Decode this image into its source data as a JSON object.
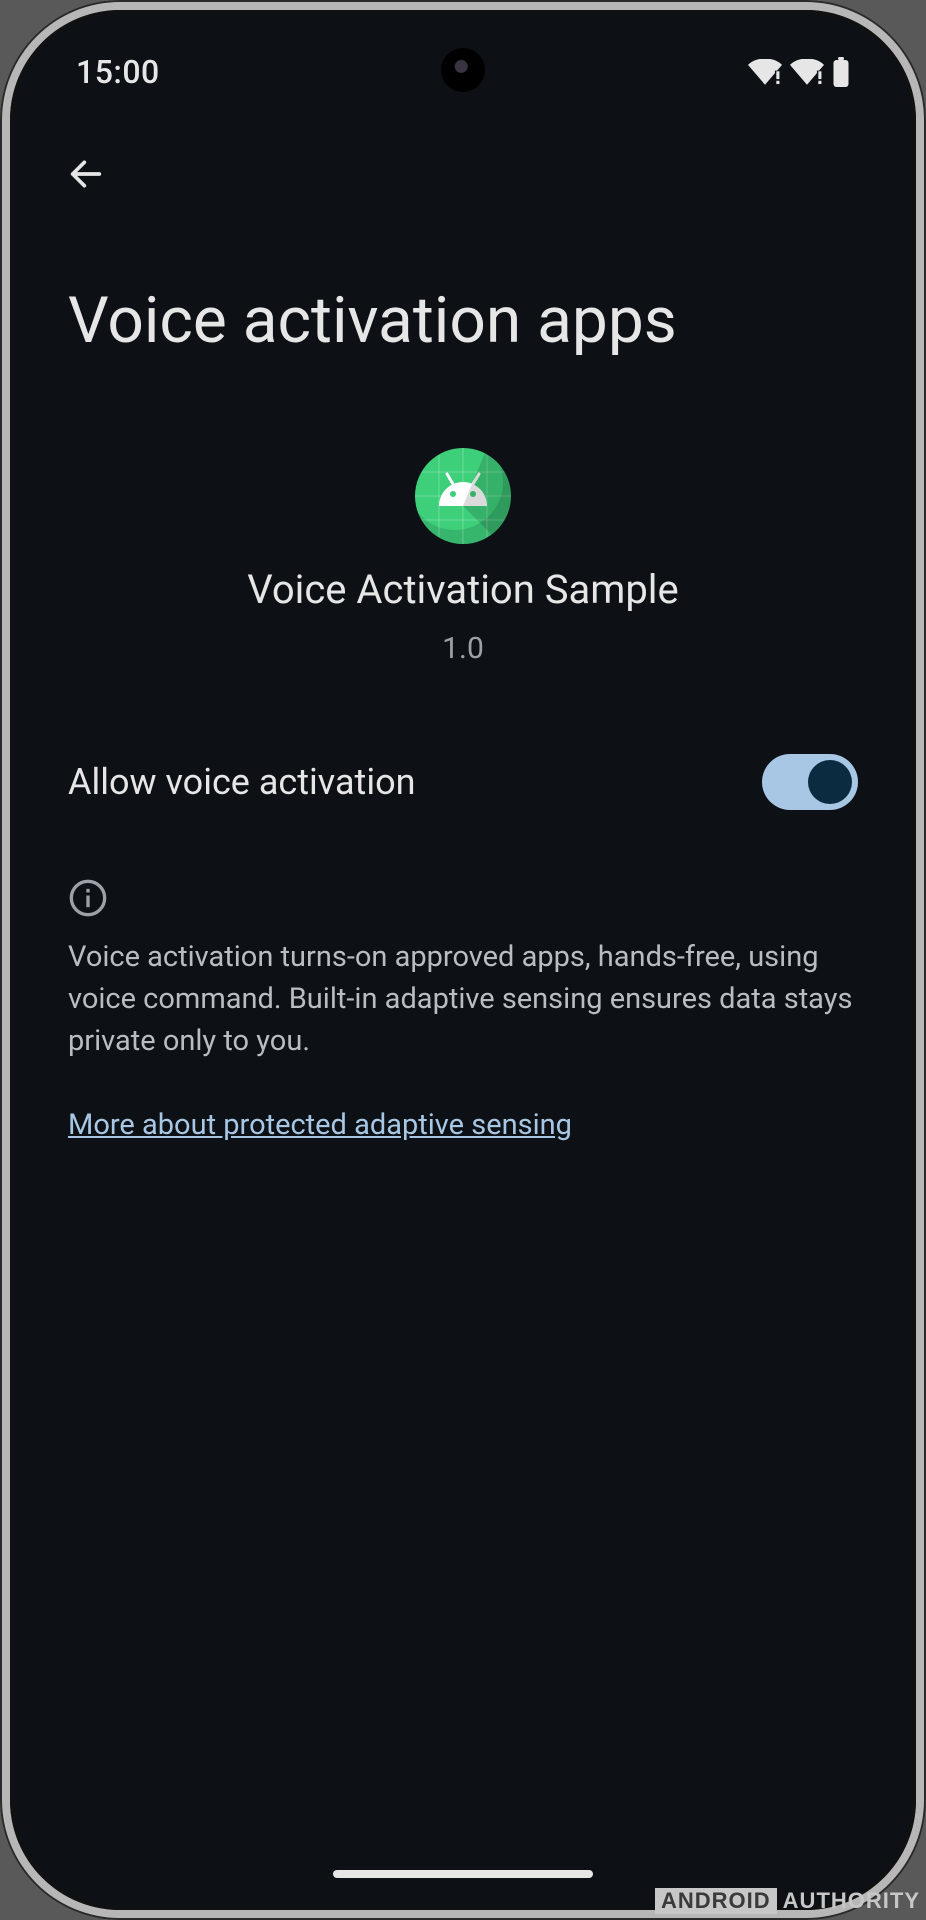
{
  "statusbar": {
    "time": "15:00"
  },
  "page": {
    "title": "Voice activation apps"
  },
  "app": {
    "name": "Voice Activation Sample",
    "version": "1.0"
  },
  "setting": {
    "label": "Allow voice activation",
    "enabled": true
  },
  "info": {
    "text": "Voice activation turns-on approved apps, hands-free, using voice command. Built-in adaptive sensing ensures data stays private only to you.",
    "link_label": "More about protected adaptive sensing"
  },
  "watermark": {
    "brand_a": "ANDROID",
    "brand_b": "AUTHORITY"
  }
}
